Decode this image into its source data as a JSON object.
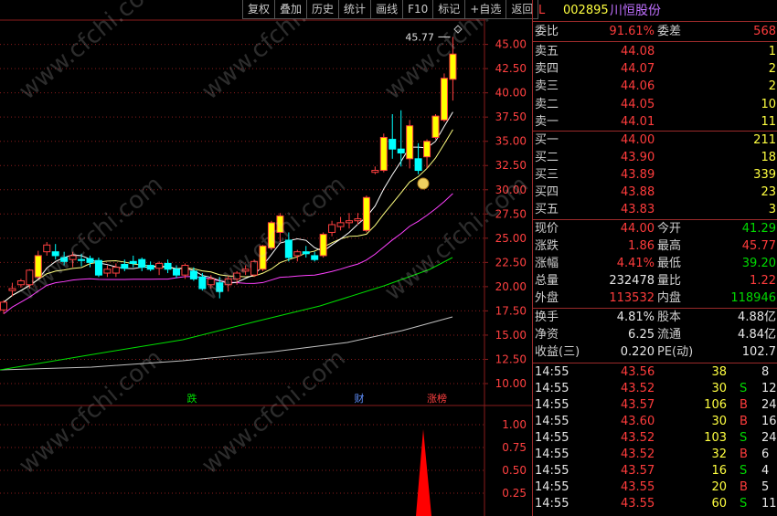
{
  "toolbar": {
    "buttons": [
      "复权",
      "叠加",
      "历史",
      "统计",
      "画线",
      "F10",
      "标记",
      "+自选",
      "返回"
    ]
  },
  "stock": {
    "flag": "L",
    "code": "002895",
    "name": "川恒股份"
  },
  "weibi": {
    "label1": "委比",
    "value1": "91.61%",
    "label2": "委差",
    "value2": "568"
  },
  "asks": [
    {
      "label": "卖五",
      "price": "44.08",
      "vol": "1"
    },
    {
      "label": "卖四",
      "price": "44.07",
      "vol": "2"
    },
    {
      "label": "卖三",
      "price": "44.06",
      "vol": "2"
    },
    {
      "label": "卖二",
      "price": "44.05",
      "vol": "10"
    },
    {
      "label": "卖一",
      "price": "44.01",
      "vol": "11"
    }
  ],
  "bids": [
    {
      "label": "买一",
      "price": "44.00",
      "vol": "211"
    },
    {
      "label": "买二",
      "price": "43.90",
      "vol": "18"
    },
    {
      "label": "买三",
      "price": "43.89",
      "vol": "339"
    },
    {
      "label": "买四",
      "price": "43.88",
      "vol": "23"
    },
    {
      "label": "买五",
      "price": "43.83",
      "vol": "3"
    }
  ],
  "quote": [
    {
      "l1": "现价",
      "v1": "44.00",
      "l2": "今开",
      "v2": "41.29",
      "c1": "red",
      "c2": "green"
    },
    {
      "l1": "涨跌",
      "v1": "1.86",
      "l2": "最高",
      "v2": "45.77",
      "c1": "red",
      "c2": "red"
    },
    {
      "l1": "涨幅",
      "v1": "4.41%",
      "l2": "最低",
      "v2": "39.20",
      "c1": "red",
      "c2": "green"
    },
    {
      "l1": "总量",
      "v1": "232478",
      "l2": "量比",
      "v2": "1.22",
      "c1": "white",
      "c2": "red"
    },
    {
      "l1": "外盘",
      "v1": "113532",
      "l2": "内盘",
      "v2": "118946",
      "c1": "red",
      "c2": "green"
    }
  ],
  "fundamentals": [
    {
      "l1": "换手",
      "v1": "4.81%",
      "l2": "股本",
      "v2": "4.88亿"
    },
    {
      "l1": "净资",
      "v1": "6.25",
      "l2": "流通",
      "v2": "4.84亿"
    },
    {
      "l1": "收益(三)",
      "v1": "0.220",
      "l2": "PE(动)",
      "v2": "102.7"
    }
  ],
  "ticks": [
    {
      "time": "14:55",
      "price": "43.56",
      "vol": "38",
      "side": "",
      "num": "8",
      "color": "red"
    },
    {
      "time": "14:55",
      "price": "43.52",
      "vol": "30",
      "side": "S",
      "num": "12",
      "color": "red"
    },
    {
      "time": "14:55",
      "price": "43.57",
      "vol": "106",
      "side": "B",
      "num": "24",
      "color": "red"
    },
    {
      "time": "14:55",
      "price": "43.60",
      "vol": "30",
      "side": "B",
      "num": "16",
      "color": "red"
    },
    {
      "time": "14:55",
      "price": "43.52",
      "vol": "103",
      "side": "S",
      "num": "24",
      "color": "red"
    },
    {
      "time": "14:55",
      "price": "43.52",
      "vol": "32",
      "side": "B",
      "num": "6",
      "color": "red"
    },
    {
      "time": "14:55",
      "price": "43.57",
      "vol": "16",
      "side": "S",
      "num": "4",
      "color": "red"
    },
    {
      "time": "14:55",
      "price": "43.55",
      "vol": "20",
      "side": "B",
      "num": "5",
      "color": "red"
    },
    {
      "time": "14:55",
      "price": "43.55",
      "vol": "60",
      "side": "S",
      "num": "11",
      "color": "red"
    }
  ],
  "colors": {
    "up": "#ff3c3c",
    "down": "#00ffff",
    "limit_up": "#ffff00",
    "ma5": "#ffffff",
    "ma10": "#ffff80",
    "ma20": "#ff40ff",
    "ma60": "#00e000",
    "ma120": "#c0c0c0",
    "grid": "#8a1c1c"
  },
  "watermark": "www.cfchi.com",
  "chart_data": {
    "type": "candlestick",
    "price_axis": {
      "ticks": [
        "45.00",
        "42.50",
        "40.00",
        "37.50",
        "35.00",
        "32.50",
        "30.00",
        "27.50",
        "25.00",
        "22.50",
        "20.00",
        "17.50",
        "15.00",
        "12.50",
        "10.00"
      ]
    },
    "volume_axis": {
      "ticks": [
        "1.00",
        "0.75",
        "0.50",
        "0.25"
      ]
    },
    "max_annotation": "45.77",
    "event_markers": [
      {
        "label": "跌",
        "color": "green"
      },
      {
        "label": "财",
        "color": "blue"
      },
      {
        "label": "涨榜",
        "color": "red"
      }
    ],
    "candles": [
      {
        "o": 17.6,
        "h": 18.6,
        "l": 17.2,
        "c": 18.4
      },
      {
        "o": 19.6,
        "h": 20.4,
        "l": 19.0,
        "c": 19.8
      },
      {
        "o": 20.2,
        "h": 20.8,
        "l": 19.9,
        "c": 20.6
      },
      {
        "o": 20.2,
        "h": 21.8,
        "l": 19.8,
        "c": 21.7
      },
      {
        "o": 21.0,
        "h": 23.7,
        "l": 20.8,
        "c": 23.2
      },
      {
        "o": 23.6,
        "h": 24.6,
        "l": 23.2,
        "c": 24.3
      },
      {
        "o": 23.6,
        "h": 24.4,
        "l": 22.8,
        "c": 23.2
      },
      {
        "o": 23.0,
        "h": 23.6,
        "l": 22.2,
        "c": 22.6
      },
      {
        "o": 22.8,
        "h": 23.6,
        "l": 22.0,
        "c": 23.2
      },
      {
        "o": 22.8,
        "h": 23.4,
        "l": 22.1,
        "c": 22.7
      },
      {
        "o": 22.9,
        "h": 23.2,
        "l": 22.0,
        "c": 22.5
      },
      {
        "o": 22.7,
        "h": 23.0,
        "l": 21.0,
        "c": 21.2
      },
      {
        "o": 21.4,
        "h": 22.2,
        "l": 21.0,
        "c": 21.8
      },
      {
        "o": 21.4,
        "h": 22.4,
        "l": 21.0,
        "c": 22.0
      },
      {
        "o": 22.3,
        "h": 22.8,
        "l": 21.6,
        "c": 21.9
      },
      {
        "o": 22.6,
        "h": 23.2,
        "l": 22.0,
        "c": 22.4
      },
      {
        "o": 22.8,
        "h": 23.0,
        "l": 21.6,
        "c": 22.0
      },
      {
        "o": 22.2,
        "h": 22.6,
        "l": 21.6,
        "c": 21.8
      },
      {
        "o": 21.9,
        "h": 22.6,
        "l": 21.2,
        "c": 22.4
      },
      {
        "o": 22.4,
        "h": 22.8,
        "l": 21.4,
        "c": 21.8
      },
      {
        "o": 21.8,
        "h": 22.2,
        "l": 20.9,
        "c": 21.2
      },
      {
        "o": 21.2,
        "h": 22.4,
        "l": 20.8,
        "c": 22.2
      },
      {
        "o": 21.6,
        "h": 22.0,
        "l": 20.6,
        "c": 20.8
      },
      {
        "o": 21.0,
        "h": 21.4,
        "l": 19.6,
        "c": 19.8
      },
      {
        "o": 20.2,
        "h": 21.2,
        "l": 19.8,
        "c": 20.8
      },
      {
        "o": 20.4,
        "h": 21.0,
        "l": 18.8,
        "c": 19.5
      },
      {
        "o": 20.2,
        "h": 21.1,
        "l": 19.5,
        "c": 20.8
      },
      {
        "o": 20.8,
        "h": 21.6,
        "l": 20.2,
        "c": 21.4
      },
      {
        "o": 21.6,
        "h": 22.2,
        "l": 21.2,
        "c": 21.8
      },
      {
        "o": 21.2,
        "h": 22.8,
        "l": 21.0,
        "c": 22.6
      },
      {
        "o": 21.8,
        "h": 24.3,
        "l": 21.6,
        "c": 24.2
      },
      {
        "o": 24.0,
        "h": 26.8,
        "l": 23.8,
        "c": 26.6
      },
      {
        "o": 25.6,
        "h": 27.6,
        "l": 24.6,
        "c": 27.3
      },
      {
        "o": 24.8,
        "h": 25.6,
        "l": 22.6,
        "c": 23.0
      },
      {
        "o": 23.2,
        "h": 23.8,
        "l": 22.6,
        "c": 23.6
      },
      {
        "o": 23.6,
        "h": 24.2,
        "l": 23.0,
        "c": 23.4
      },
      {
        "o": 23.2,
        "h": 23.6,
        "l": 22.6,
        "c": 22.8
      },
      {
        "o": 23.2,
        "h": 25.6,
        "l": 23.0,
        "c": 25.4
      },
      {
        "o": 25.6,
        "h": 26.8,
        "l": 25.2,
        "c": 26.4
      },
      {
        "o": 26.2,
        "h": 27.2,
        "l": 25.8,
        "c": 26.6
      },
      {
        "o": 26.6,
        "h": 27.6,
        "l": 26.0,
        "c": 26.8
      },
      {
        "o": 26.8,
        "h": 27.6,
        "l": 26.4,
        "c": 27.0
      },
      {
        "o": 25.8,
        "h": 29.4,
        "l": 25.6,
        "c": 29.2
      },
      {
        "o": 31.8,
        "h": 32.4,
        "l": 31.6,
        "c": 32.0
      },
      {
        "o": 32.0,
        "h": 35.8,
        "l": 31.8,
        "c": 35.4
      },
      {
        "o": 35.2,
        "h": 37.8,
        "l": 33.2,
        "c": 34.2
      },
      {
        "o": 34.2,
        "h": 38.2,
        "l": 32.4,
        "c": 33.8
      },
      {
        "o": 33.2,
        "h": 37.2,
        "l": 32.2,
        "c": 36.6
      },
      {
        "o": 33.2,
        "h": 34.8,
        "l": 31.6,
        "c": 32.0
      },
      {
        "o": 33.4,
        "h": 35.2,
        "l": 32.2,
        "c": 35.0
      },
      {
        "o": 35.4,
        "h": 37.8,
        "l": 35.2,
        "c": 37.6
      },
      {
        "o": 37.2,
        "h": 42.0,
        "l": 37.0,
        "c": 41.5
      },
      {
        "o": 41.4,
        "h": 45.77,
        "l": 39.2,
        "c": 44.0
      }
    ]
  }
}
